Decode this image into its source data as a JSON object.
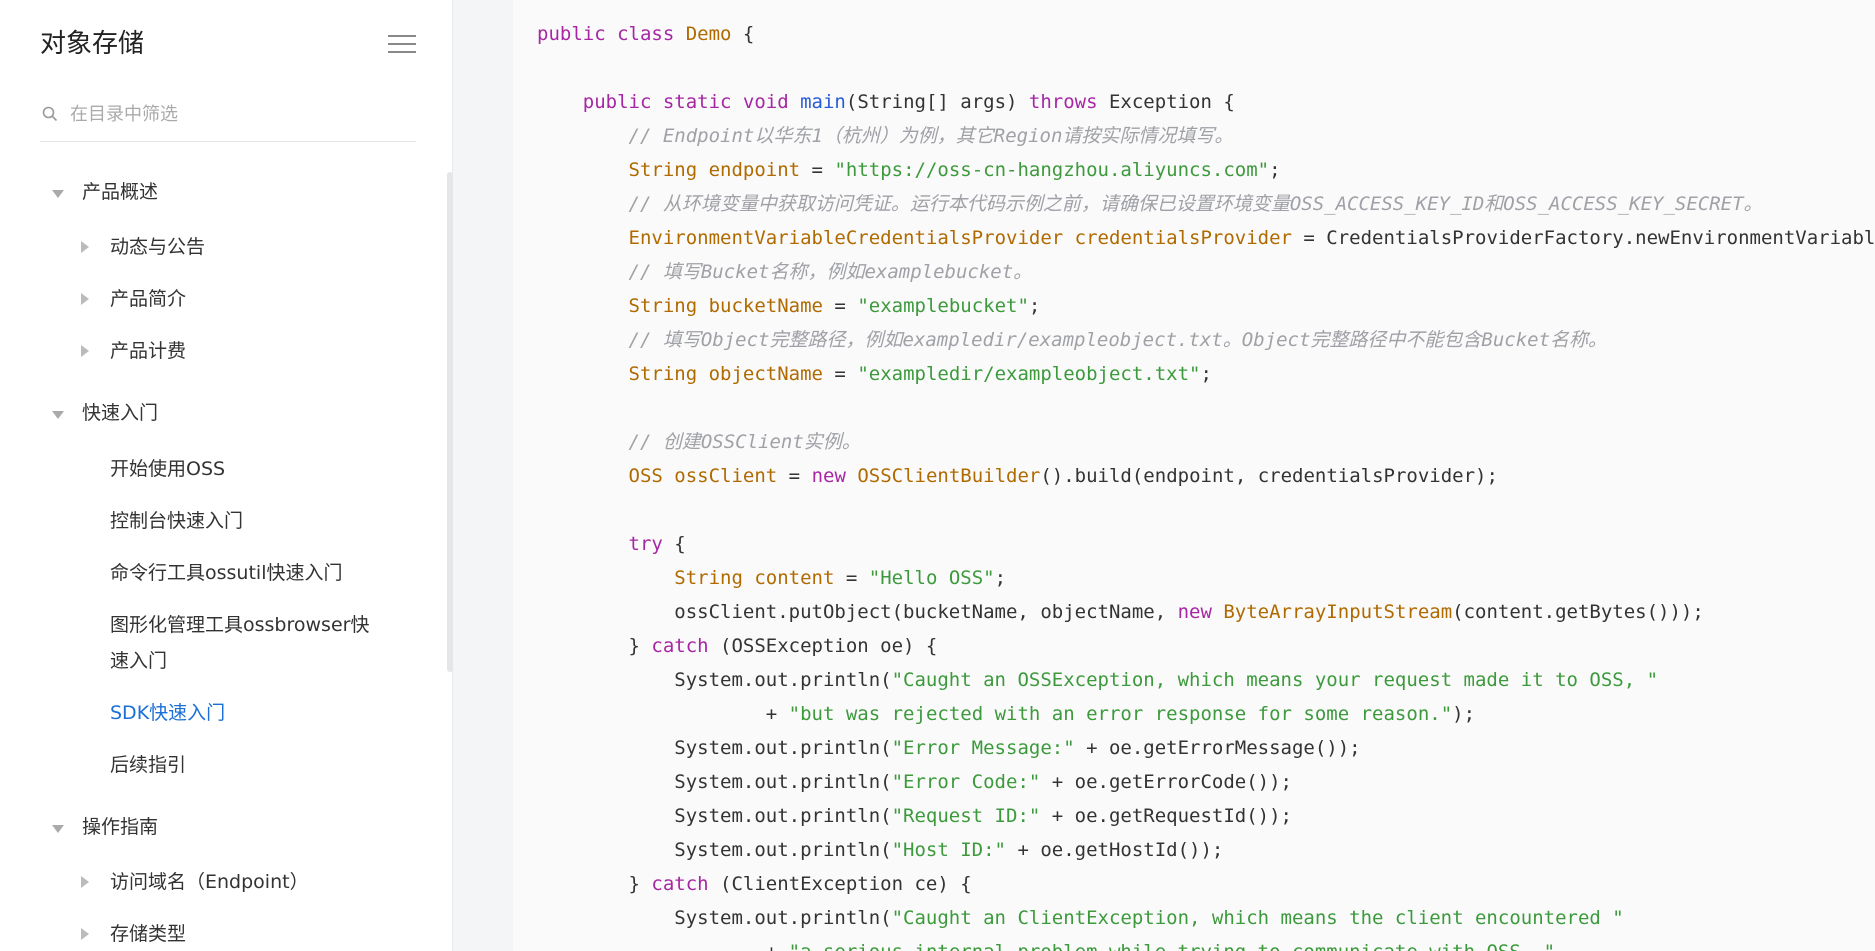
{
  "sidebar": {
    "title": "对象存储",
    "filter_placeholder": "在目录中筛选",
    "items": [
      {
        "label": "产品概述",
        "level": 0,
        "expanded": true
      },
      {
        "label": "动态与公告",
        "level": 1,
        "expanded": false
      },
      {
        "label": "产品简介",
        "level": 1,
        "expanded": false
      },
      {
        "label": "产品计费",
        "level": 1,
        "expanded": false
      },
      {
        "label": "快速入门",
        "level": 0,
        "expanded": true
      },
      {
        "label": "开始使用OSS",
        "level": 1
      },
      {
        "label": "控制台快速入门",
        "level": 1
      },
      {
        "label": "命令行工具ossutil快速入门",
        "level": 1
      },
      {
        "label": "图形化管理工具ossbrowser快",
        "level": 1
      },
      {
        "label": "速入门",
        "level": 1
      },
      {
        "label": "SDK快速入门",
        "level": 1,
        "active": true
      },
      {
        "label": "后续指引",
        "level": 1
      },
      {
        "label": "操作指南",
        "level": 0,
        "expanded": true
      },
      {
        "label": "访问域名（Endpoint）",
        "level": 1,
        "expanded": false
      },
      {
        "label": "存储类型",
        "level": 1,
        "expanded": false
      }
    ]
  },
  "code": {
    "language": "java",
    "lines": [
      [
        [
          "kw",
          "public class "
        ],
        [
          "ty",
          "Demo"
        ],
        [
          "pl",
          " {"
        ]
      ],
      [],
      [
        [
          "pl",
          "    "
        ],
        [
          "kw",
          "public static void "
        ],
        [
          "fn",
          "main"
        ],
        [
          "pl",
          "(String[] args) "
        ],
        [
          "kw",
          "throws"
        ],
        [
          "pl",
          " Exception {"
        ]
      ],
      [
        [
          "pl",
          "        "
        ],
        [
          "cm",
          "// Endpoint以华东1（杭州）为例，其它Region请按实际情况填写。"
        ]
      ],
      [
        [
          "pl",
          "        "
        ],
        [
          "ty",
          "String endpoint"
        ],
        [
          "pl",
          " = "
        ],
        [
          "st",
          "\"https://oss-cn-hangzhou.aliyuncs.com\""
        ],
        [
          "pl",
          ";"
        ]
      ],
      [
        [
          "pl",
          "        "
        ],
        [
          "cm",
          "// 从环境变量中获取访问凭证。运行本代码示例之前，请确保已设置环境变量OSS_ACCESS_KEY_ID和OSS_ACCESS_KEY_SECRET。"
        ]
      ],
      [
        [
          "pl",
          "        "
        ],
        [
          "ty",
          "EnvironmentVariableCredentialsProvider credentialsProvider"
        ],
        [
          "pl",
          " = CredentialsProviderFactory.newEnvironmentVariableCredentialsProvider();"
        ]
      ],
      [
        [
          "pl",
          "        "
        ],
        [
          "cm",
          "// 填写Bucket名称，例如examplebucket。"
        ]
      ],
      [
        [
          "pl",
          "        "
        ],
        [
          "ty",
          "String bucketName"
        ],
        [
          "pl",
          " = "
        ],
        [
          "st",
          "\"examplebucket\""
        ],
        [
          "pl",
          ";"
        ]
      ],
      [
        [
          "pl",
          "        "
        ],
        [
          "cm",
          "// 填写Object完整路径，例如exampledir/exampleobject.txt。Object完整路径中不能包含Bucket名称。"
        ]
      ],
      [
        [
          "pl",
          "        "
        ],
        [
          "ty",
          "String objectName"
        ],
        [
          "pl",
          " = "
        ],
        [
          "st",
          "\"exampledir/exampleobject.txt\""
        ],
        [
          "pl",
          ";"
        ]
      ],
      [],
      [
        [
          "pl",
          "        "
        ],
        [
          "cm",
          "// 创建OSSClient实例。"
        ]
      ],
      [
        [
          "pl",
          "        "
        ],
        [
          "ty",
          "OSS ossClient"
        ],
        [
          "pl",
          " = "
        ],
        [
          "kw",
          "new "
        ],
        [
          "ty",
          "OSSClientBuilder"
        ],
        [
          "pl",
          "().build(endpoint, credentialsProvider);"
        ]
      ],
      [],
      [
        [
          "pl",
          "        "
        ],
        [
          "kw",
          "try"
        ],
        [
          "pl",
          " {"
        ]
      ],
      [
        [
          "pl",
          "            "
        ],
        [
          "ty",
          "String content"
        ],
        [
          "pl",
          " = "
        ],
        [
          "st",
          "\"Hello OSS\""
        ],
        [
          "pl",
          ";"
        ]
      ],
      [
        [
          "pl",
          "            ossClient.putObject(bucketName, objectName, "
        ],
        [
          "kw",
          "new "
        ],
        [
          "ty",
          "ByteArrayInputStream"
        ],
        [
          "pl",
          "(content.getBytes()));"
        ]
      ],
      [
        [
          "pl",
          "        } "
        ],
        [
          "kw",
          "catch"
        ],
        [
          "pl",
          " (OSSException oe) {"
        ]
      ],
      [
        [
          "pl",
          "            System.out.println("
        ],
        [
          "st",
          "\"Caught an OSSException, which means your request made it to OSS, \""
        ]
      ],
      [
        [
          "pl",
          "                    + "
        ],
        [
          "st",
          "\"but was rejected with an error response for some reason.\""
        ],
        [
          "pl",
          ");"
        ]
      ],
      [
        [
          "pl",
          "            System.out.println("
        ],
        [
          "st",
          "\"Error Message:\""
        ],
        [
          "pl",
          " + oe.getErrorMessage());"
        ]
      ],
      [
        [
          "pl",
          "            System.out.println("
        ],
        [
          "st",
          "\"Error Code:\""
        ],
        [
          "pl",
          " + oe.getErrorCode());"
        ]
      ],
      [
        [
          "pl",
          "            System.out.println("
        ],
        [
          "st",
          "\"Request ID:\""
        ],
        [
          "pl",
          " + oe.getRequestId());"
        ]
      ],
      [
        [
          "pl",
          "            System.out.println("
        ],
        [
          "st",
          "\"Host ID:\""
        ],
        [
          "pl",
          " + oe.getHostId());"
        ]
      ],
      [
        [
          "pl",
          "        } "
        ],
        [
          "kw",
          "catch"
        ],
        [
          "pl",
          " (ClientException ce) {"
        ]
      ],
      [
        [
          "pl",
          "            System.out.println("
        ],
        [
          "st",
          "\"Caught an ClientException, which means the client encountered \""
        ]
      ],
      [
        [
          "pl",
          "                    + "
        ],
        [
          "st",
          "\"a serious internal problem while trying to communicate with OSS, \""
        ]
      ]
    ]
  },
  "colors": {
    "accent": "#1a6fd8",
    "keyword": "#a626a4",
    "type": "#b06a00",
    "function": "#2a5bd7",
    "string": "#3c9a3c",
    "comment": "#a0a1a7"
  }
}
